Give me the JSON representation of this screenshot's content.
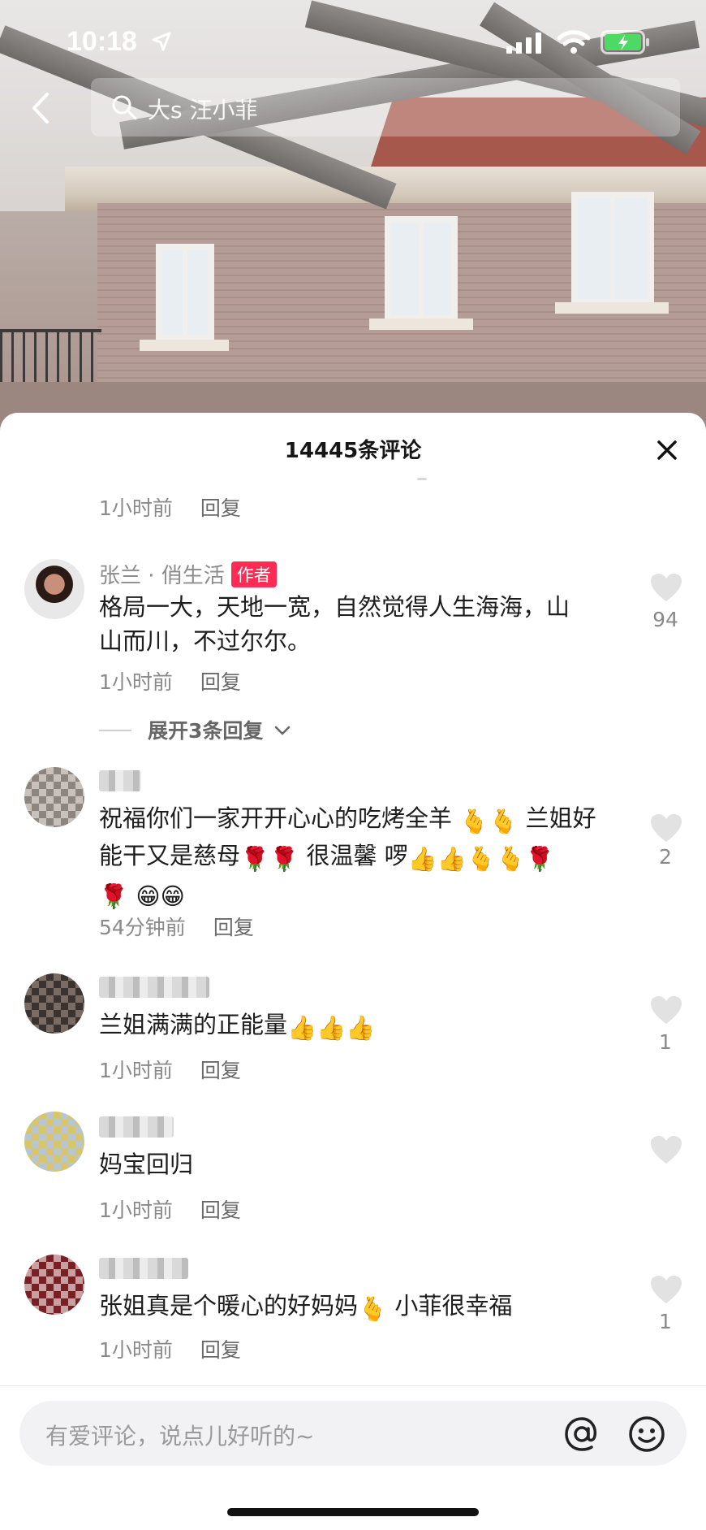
{
  "status": {
    "time": "10:18"
  },
  "search": {
    "query": "大s 汪小菲"
  },
  "sheet": {
    "title": "14445条评论"
  },
  "top_meta": {
    "time": "1小时前",
    "reply": "回复"
  },
  "comments": [
    {
      "user": "张兰 · 俏生活",
      "badge": "作者",
      "text_line1": "格局一大，天地一宽，自然觉得人生海海，山",
      "text_line2": "山而川，不过尔尔。",
      "time": "1小时前",
      "reply": "回复",
      "likes": "94"
    },
    {
      "user": "",
      "text_line1": "祝福你们一家开开心心的吃烤全羊",
      "text_line1b": "兰姐好",
      "text_line2a": "能干又是慈母",
      "text_line2b": "很温馨 啰",
      "time": "54分钟前",
      "reply": "回复",
      "likes": "2"
    },
    {
      "user": "",
      "text": "兰姐满满的正能量",
      "time": "1小时前",
      "reply": "回复",
      "likes": "1"
    },
    {
      "user": "",
      "text": "妈宝回归",
      "time": "1小时前",
      "reply": "回复",
      "likes": ""
    },
    {
      "user": "",
      "text_a": "张姐真是个暖心的好妈妈",
      "text_b": "小菲很幸福",
      "time": "1小时前",
      "reply": "回复",
      "likes": "1"
    }
  ],
  "expand": {
    "label": "展开3条回复"
  },
  "input": {
    "placeholder": "有爱评论，说点儿好听的~"
  },
  "colors": {
    "author_badge": "#fe2c55",
    "sheet_bg": "#ffffff",
    "input_bg": "#f2f2f4"
  }
}
